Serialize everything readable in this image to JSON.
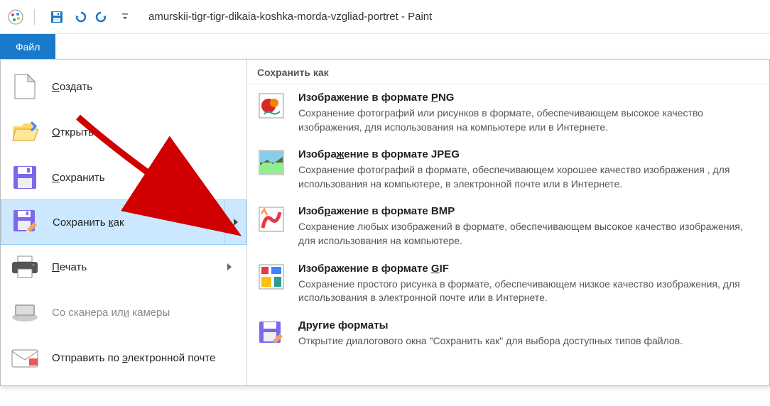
{
  "window": {
    "title": "amurskii-tigr-tigr-dikaia-koshka-morda-vzgliad-portret - Paint"
  },
  "tabs": {
    "file": "Файл"
  },
  "file_menu": {
    "new": "Создать",
    "open": "Открыть",
    "save": "Сохранить",
    "save_as": "Сохранить как",
    "print": "Печать",
    "scanner": "Со сканера или камеры",
    "email": "Отправить по электронной почте"
  },
  "save_as_panel": {
    "header": "Сохранить как",
    "formats": [
      {
        "title": "Изображение в формате PNG",
        "desc": "Сохранение фотографий или рисунков в формате, обеспечивающем высокое качество изображения, для использования на компьютере или в Интернете."
      },
      {
        "title": "Изображение в формате JPEG",
        "desc": "Сохранение фотографий в формате, обеспечивающем хорошее качество изображения , для использования на компьютере, в электронной почте или в Интернете."
      },
      {
        "title": "Изображение в формате BMP",
        "desc": "Сохранение любых изображений в формате, обеспечивающем высокое качество изображения, для использования на компьютере."
      },
      {
        "title": "Изображение в формате GIF",
        "desc": "Сохранение простого рисунка в формате, обеспечивающем низкое качество изображения, для использования в электронной почте или в Интернете."
      },
      {
        "title": "Другие форматы",
        "desc": "Открытие диалогового окна \"Сохранить как\" для выбора доступных типов файлов."
      }
    ]
  }
}
